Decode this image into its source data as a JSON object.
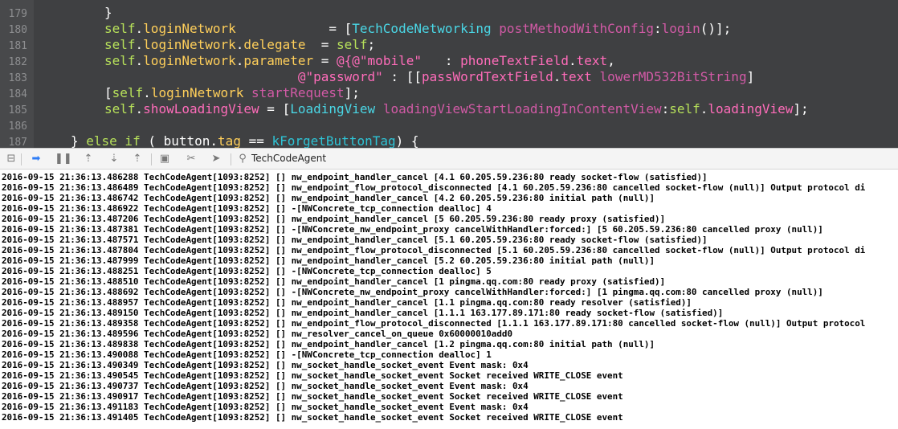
{
  "editor": {
    "line_numbers": [
      "179",
      "180",
      "181",
      "182",
      "183",
      "184",
      "185",
      "186",
      "187"
    ],
    "lines": [
      [
        {
          "t": "}",
          "c": "p"
        }
      ],
      [
        {
          "t": "self",
          "c": "s"
        },
        {
          "t": ".",
          "c": "p"
        },
        {
          "t": "loginNetwork",
          "c": "m"
        },
        {
          "t": "            = [",
          "c": "p"
        },
        {
          "t": "TechCodeNetworking",
          "c": "f"
        },
        {
          "t": " ",
          "c": "p"
        },
        {
          "t": "postMethodWithConfig",
          "c": "x"
        },
        {
          "t": ":",
          "c": "p"
        },
        {
          "t": "login",
          "c": "x"
        },
        {
          "t": "()];",
          "c": "p"
        }
      ],
      [
        {
          "t": "self",
          "c": "s"
        },
        {
          "t": ".",
          "c": "p"
        },
        {
          "t": "loginNetwork",
          "c": "m"
        },
        {
          "t": ".",
          "c": "p"
        },
        {
          "t": "delegate",
          "c": "m"
        },
        {
          "t": "  = ",
          "c": "p"
        },
        {
          "t": "self",
          "c": "s"
        },
        {
          "t": ";",
          "c": "p"
        }
      ],
      [
        {
          "t": "self",
          "c": "s"
        },
        {
          "t": ".",
          "c": "p"
        },
        {
          "t": "loginNetwork",
          "c": "m"
        },
        {
          "t": ".",
          "c": "p"
        },
        {
          "t": "parameter",
          "c": "m"
        },
        {
          "t": " = ",
          "c": "p"
        },
        {
          "t": "@{@\"mobile\"",
          "c": "st"
        },
        {
          "t": "   : ",
          "c": "p"
        },
        {
          "t": "phoneTextField",
          "c": "st"
        },
        {
          "t": ".",
          "c": "p"
        },
        {
          "t": "text",
          "c": "st"
        },
        {
          "t": ",",
          "c": "p"
        }
      ],
      [
        {
          "t": "                         ",
          "c": "p"
        },
        {
          "t": "@\"password\"",
          "c": "st"
        },
        {
          "t": " : [[",
          "c": "p"
        },
        {
          "t": "passWordTextField",
          "c": "st"
        },
        {
          "t": ".",
          "c": "p"
        },
        {
          "t": "text",
          "c": "st"
        },
        {
          "t": " ",
          "c": "p"
        },
        {
          "t": "lowerMD532BitString",
          "c": "x"
        },
        {
          "t": "]",
          "c": "p"
        }
      ],
      [
        {
          "t": "[",
          "c": "p"
        },
        {
          "t": "self",
          "c": "s"
        },
        {
          "t": ".",
          "c": "p"
        },
        {
          "t": "loginNetwork",
          "c": "m"
        },
        {
          "t": " ",
          "c": "p"
        },
        {
          "t": "startRequest",
          "c": "x"
        },
        {
          "t": "];",
          "c": "p"
        }
      ],
      [
        {
          "t": "self",
          "c": "s"
        },
        {
          "t": ".",
          "c": "p"
        },
        {
          "t": "showLoadingView",
          "c": "st"
        },
        {
          "t": " = [",
          "c": "p"
        },
        {
          "t": "LoadingView",
          "c": "f"
        },
        {
          "t": " ",
          "c": "p"
        },
        {
          "t": "loadingViewStartLoadingInContentView",
          "c": "x"
        },
        {
          "t": ":",
          "c": "p"
        },
        {
          "t": "self",
          "c": "s"
        },
        {
          "t": ".",
          "c": "p"
        },
        {
          "t": "loadingView",
          "c": "st"
        },
        {
          "t": "];",
          "c": "p"
        }
      ],
      [],
      [
        {
          "t": "} ",
          "c": "p"
        },
        {
          "t": "else if",
          "c": "s"
        },
        {
          "t": " ( ",
          "c": "p"
        },
        {
          "t": "button",
          "c": "p"
        },
        {
          "t": ".",
          "c": "p"
        },
        {
          "t": "tag",
          "c": "m"
        },
        {
          "t": " == ",
          "c": "p"
        },
        {
          "t": "kForgetButtonTag",
          "c": "k"
        },
        {
          "t": ") {",
          "c": "p"
        }
      ]
    ]
  },
  "debug_bar": {
    "icons": [
      "hide-debug-area-icon",
      "breakpoints-icon",
      "pause-icon",
      "step-over-icon",
      "step-into-icon",
      "step-out-icon",
      "view-hierarchy-icon",
      "memory-graph-icon",
      "simulate-location-icon"
    ],
    "glyphs": [
      "⊟",
      "➡",
      "❚❚",
      "⇡",
      "⇣",
      "⇡",
      "▣",
      "✂",
      "➤"
    ],
    "thread_icon": "thread-icon",
    "thread_label": "TechCodeAgent"
  },
  "console": {
    "lines": [
      "2016-09-15 21:36:13.486288 TechCodeAgent[1093:8252] [] nw_endpoint_handler_cancel [4.1 60.205.59.236:80 ready socket-flow (satisfied)]",
      "2016-09-15 21:36:13.486489 TechCodeAgent[1093:8252] [] nw_endpoint_flow_protocol_disconnected [4.1 60.205.59.236:80 cancelled socket-flow (null)] Output protocol di",
      "2016-09-15 21:36:13.486742 TechCodeAgent[1093:8252] [] nw_endpoint_handler_cancel [4.2 60.205.59.236:80 initial path (null)]",
      "2016-09-15 21:36:13.486922 TechCodeAgent[1093:8252] [] -[NWConcrete_tcp_connection dealloc] 4",
      "2016-09-15 21:36:13.487206 TechCodeAgent[1093:8252] [] nw_endpoint_handler_cancel [5 60.205.59.236:80 ready proxy (satisfied)]",
      "2016-09-15 21:36:13.487381 TechCodeAgent[1093:8252] [] -[NWConcrete_nw_endpoint_proxy cancelWithHandler:forced:] [5 60.205.59.236:80 cancelled proxy (null)]",
      "2016-09-15 21:36:13.487571 TechCodeAgent[1093:8252] [] nw_endpoint_handler_cancel [5.1 60.205.59.236:80 ready socket-flow (satisfied)]",
      "2016-09-15 21:36:13.487804 TechCodeAgent[1093:8252] [] nw_endpoint_flow_protocol_disconnected [5.1 60.205.59.236:80 cancelled socket-flow (null)] Output protocol di",
      "2016-09-15 21:36:13.487999 TechCodeAgent[1093:8252] [] nw_endpoint_handler_cancel [5.2 60.205.59.236:80 initial path (null)]",
      "2016-09-15 21:36:13.488251 TechCodeAgent[1093:8252] [] -[NWConcrete_tcp_connection dealloc] 5",
      "2016-09-15 21:36:13.488510 TechCodeAgent[1093:8252] [] nw_endpoint_handler_cancel [1 pingma.qq.com:80 ready proxy (satisfied)]",
      "2016-09-15 21:36:13.488692 TechCodeAgent[1093:8252] [] -[NWConcrete_nw_endpoint_proxy cancelWithHandler:forced:] [1 pingma.qq.com:80 cancelled proxy (null)]",
      "2016-09-15 21:36:13.488957 TechCodeAgent[1093:8252] [] nw_endpoint_handler_cancel [1.1 pingma.qq.com:80 ready resolver (satisfied)]",
      "2016-09-15 21:36:13.489150 TechCodeAgent[1093:8252] [] nw_endpoint_handler_cancel [1.1.1 163.177.89.171:80 ready socket-flow (satisfied)]",
      "2016-09-15 21:36:13.489358 TechCodeAgent[1093:8252] [] nw_endpoint_flow_protocol_disconnected [1.1.1 163.177.89.171:80 cancelled socket-flow (null)] Output protocol",
      "2016-09-15 21:36:13.489596 TechCodeAgent[1093:8252] [] nw_resolver_cancel_on_queue 0x60000010add0",
      "2016-09-15 21:36:13.489838 TechCodeAgent[1093:8252] [] nw_endpoint_handler_cancel [1.2 pingma.qq.com:80 initial path (null)]",
      "2016-09-15 21:36:13.490088 TechCodeAgent[1093:8252] [] -[NWConcrete_tcp_connection dealloc] 1",
      "2016-09-15 21:36:13.490349 TechCodeAgent[1093:8252] [] nw_socket_handle_socket_event Event mask: 0x4",
      "2016-09-15 21:36:13.490545 TechCodeAgent[1093:8252] [] nw_socket_handle_socket_event Socket received WRITE_CLOSE event",
      "2016-09-15 21:36:13.490737 TechCodeAgent[1093:8252] [] nw_socket_handle_socket_event Event mask: 0x4",
      "2016-09-15 21:36:13.490917 TechCodeAgent[1093:8252] [] nw_socket_handle_socket_event Socket received WRITE_CLOSE event",
      "2016-09-15 21:36:13.491183 TechCodeAgent[1093:8252] [] nw_socket_handle_socket_event Event mask: 0x4",
      "2016-09-15 21:36:13.491405 TechCodeAgent[1093:8252] [] nw_socket_handle_socket_event Socket received WRITE_CLOSE event"
    ]
  }
}
